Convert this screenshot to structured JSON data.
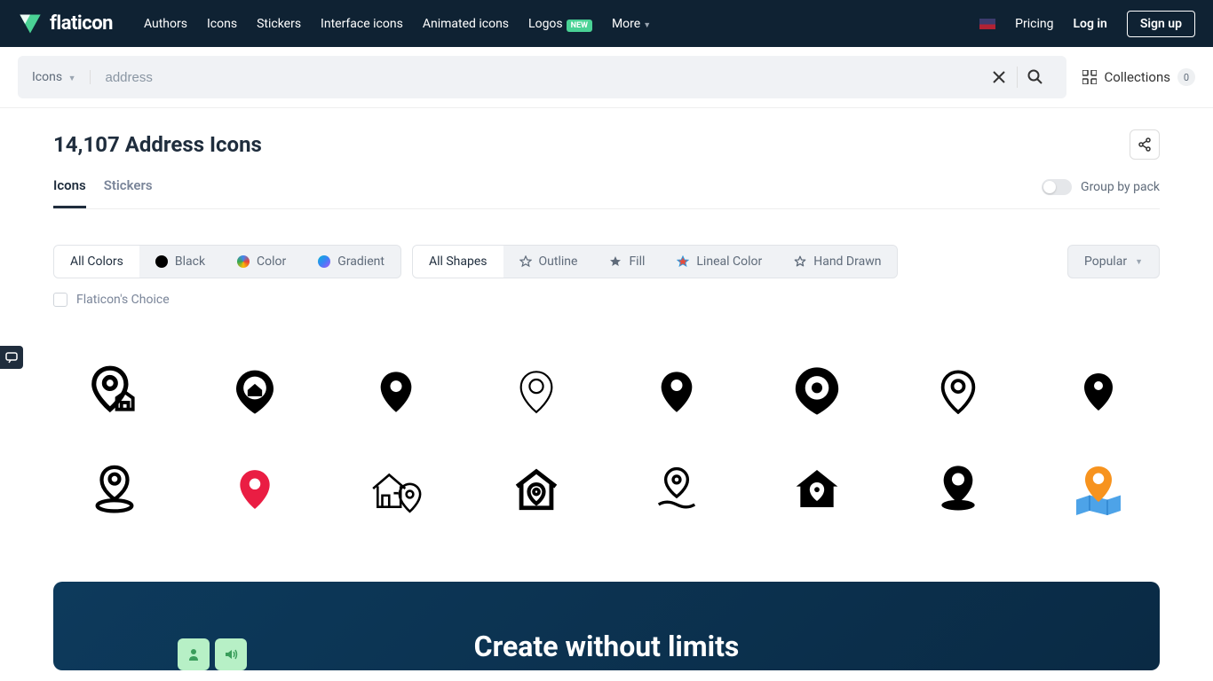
{
  "brand": "flaticon",
  "nav": {
    "authors": "Authors",
    "icons": "Icons",
    "stickers": "Stickers",
    "interface": "Interface icons",
    "animated": "Animated icons",
    "logos": "Logos",
    "logos_badge": "NEW",
    "more": "More"
  },
  "header_right": {
    "pricing": "Pricing",
    "login": "Log in",
    "signup": "Sign up"
  },
  "search": {
    "type_label": "Icons",
    "value": "address"
  },
  "collections": {
    "label": "Collections",
    "count": "0"
  },
  "page_title": "14,107 Address Icons",
  "tabs": {
    "icons": "Icons",
    "stickers": "Stickers"
  },
  "group_by_pack": "Group by pack",
  "filters": {
    "colors": {
      "all": "All Colors",
      "black": "Black",
      "color": "Color",
      "gradient": "Gradient"
    },
    "shapes": {
      "all": "All Shapes",
      "outline": "Outline",
      "fill": "Fill",
      "lineal": "Lineal Color",
      "hand": "Hand Drawn"
    }
  },
  "sort_label": "Popular",
  "choice_label": "Flaticon's Choice",
  "banner_title": "Create without limits"
}
